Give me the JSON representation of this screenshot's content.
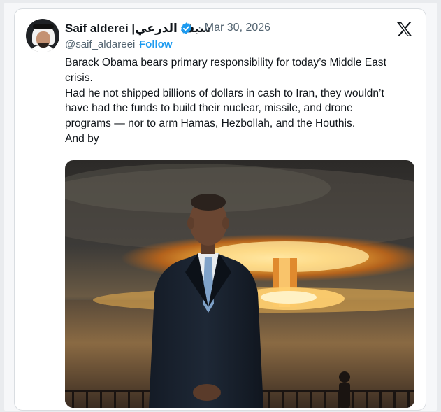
{
  "tweet": {
    "author_name": "Saif alderei |سيف الدرعي",
    "separator": "·",
    "date": "Mar 30, 2026",
    "handle": "@saif_aldareei",
    "follow_label": "Follow",
    "platform_logo": "x-logo-icon",
    "text_lines": [
      "Barack Obama bears primary responsibility for today’s Middle East",
      "crisis.",
      "Had he not shipped billions of dollars in cash to Iran, they wouldn’t",
      "have had the funds to build their nuclear, missile, and drone",
      "programs — nor to arm Hamas, Hezbollah, and the Houthis.",
      "And by"
    ]
  },
  "colors": {
    "name_text": "#0f1419",
    "secondary_text": "#536471",
    "follow_link": "#1d9bf0",
    "verified_badge": "#1d9bf0"
  },
  "icons": {
    "verified": "verified-badge-icon",
    "platform": "x-logo-icon",
    "avatar": "profile-avatar"
  }
}
